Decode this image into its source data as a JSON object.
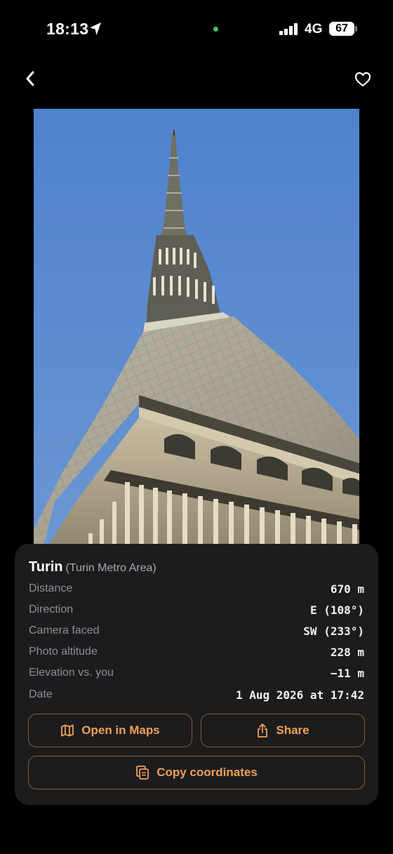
{
  "status_bar": {
    "time": "18:13",
    "network": "4G",
    "battery": "67",
    "icons": [
      "location-arrow-icon",
      "signal-bars-icon",
      "battery-icon"
    ]
  },
  "nav": {
    "back_icon": "chevron-left-icon",
    "favorite_icon": "heart-outline-icon"
  },
  "place": {
    "name": "Turin",
    "area": "(Turin Metro Area)"
  },
  "details": [
    {
      "label": "Distance",
      "value": "670 m"
    },
    {
      "label": "Direction",
      "value": "E (108°)"
    },
    {
      "label": "Camera faced",
      "value": "SW (233°)"
    },
    {
      "label": "Photo altitude",
      "value": "228 m"
    },
    {
      "label": "Elevation vs. you",
      "value": "−11 m"
    },
    {
      "label": "Date",
      "value": "1 Aug 2026 at 17:42"
    }
  ],
  "actions": {
    "open_maps": {
      "label": "Open in Maps",
      "icon": "map-icon"
    },
    "share": {
      "label": "Share",
      "icon": "share-icon"
    },
    "copy": {
      "label": "Copy coordinates",
      "icon": "copy-icon"
    }
  },
  "colors": {
    "accent": "#f0a155",
    "button_border": "#8a5a2c",
    "card_background": "#1c1c1e",
    "sky": "#5a86c7"
  }
}
